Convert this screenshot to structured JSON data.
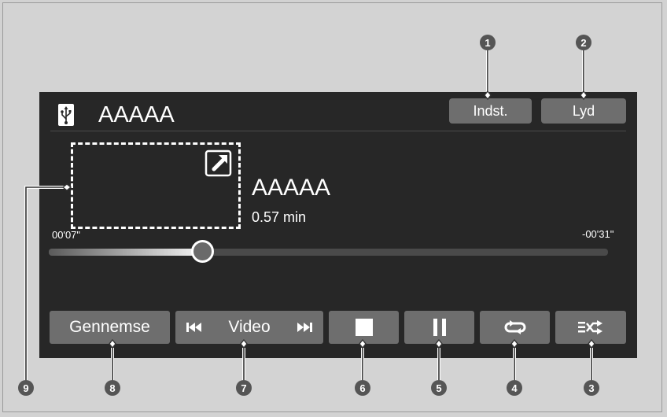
{
  "header": {
    "source_icon": "usb-icon",
    "title": "AAAAA",
    "settings_label": "Indst.",
    "sound_label": "Lyd"
  },
  "now_playing": {
    "album_art_icon": "expand-icon",
    "track_title": "AAAAA",
    "duration": "0.57 min",
    "elapsed": "00'07\"",
    "remaining": "-00'31\"",
    "progress_fraction": 0.27
  },
  "controls": {
    "browse_label": "Gennemse",
    "video_label": "Video",
    "prev_icon": "skip-back-icon",
    "next_icon": "skip-forward-icon",
    "stop_icon": "stop-icon",
    "pause_icon": "pause-icon",
    "repeat_icon": "repeat-icon",
    "shuffle_icon": "shuffle-icon"
  },
  "callouts": [
    "1",
    "2",
    "3",
    "4",
    "5",
    "6",
    "7",
    "8",
    "9"
  ],
  "colors": {
    "screen_bg": "#272727",
    "button_bg": "#6e6e6e",
    "page_bg": "#d2d2d2",
    "callout": "#555555"
  }
}
